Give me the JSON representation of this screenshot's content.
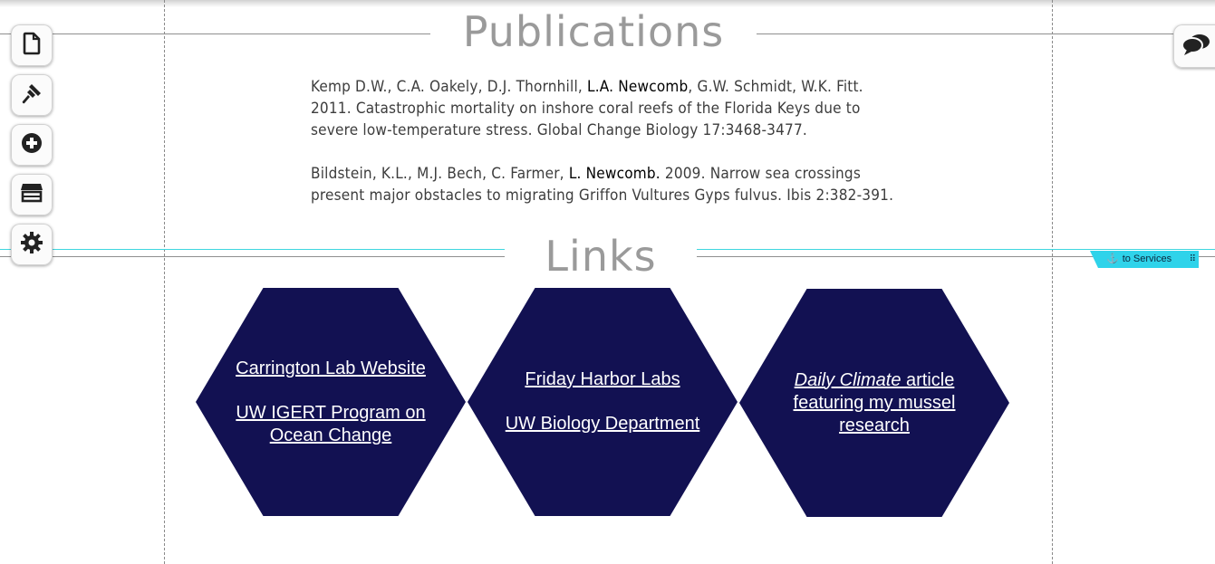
{
  "colors": {
    "hexagon_fill": "#121152",
    "anchor_tag": "#2fd3ea",
    "title_text": "#9a9a9a",
    "body_text": "#3d3d3d"
  },
  "toolbar": {
    "buttons": [
      {
        "icon": "page-icon"
      },
      {
        "icon": "paintbrush-icon"
      },
      {
        "icon": "add-circle-icon"
      },
      {
        "icon": "store-icon"
      },
      {
        "icon": "gear-icon"
      }
    ],
    "chat_icon": "chat-bubbles-icon"
  },
  "publications": {
    "title": "Publications",
    "entries": [
      {
        "before": "Kemp D.W., C.A. Oakely, D.J. Thornhill, ",
        "bold": "L.A. Newcomb",
        "after_line1": ", G.W. Schmidt, W.K. Fitt.",
        "line2": "2011. Catastrophic mortality on inshore coral reefs of the Florida Keys due to",
        "line3": "severe low-temperature stress. Global Change Biology 17:3468-3477."
      },
      {
        "before": "Bildstein, K.L., M.J. Bech, C. Farmer, ",
        "bold": "L. Newcomb.",
        "after_line1": " 2009. Narrow sea crossings",
        "line2": "present major obstacles to migrating Griffon Vultures Gyps fulvus. Ibis 2:382-391."
      }
    ]
  },
  "links": {
    "title": "Links",
    "anchor_tag_label": "to Services",
    "hexagons": [
      {
        "links": [
          "Carrington Lab Website",
          "UW IGERT Program on Ocean Change"
        ]
      },
      {
        "links": [
          "Friday Harbor Labs",
          "UW Biology Department"
        ]
      },
      {
        "link_italic": "Daily Climate",
        "link_rest": " article featuring my mussel research"
      }
    ]
  }
}
